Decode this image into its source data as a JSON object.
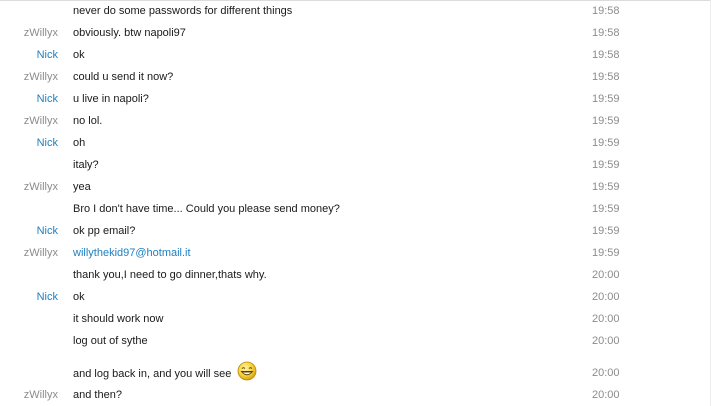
{
  "messages": [
    {
      "sender": "",
      "text": "never do some passwords for different things",
      "time": "19:58"
    },
    {
      "sender": "zWillyx",
      "text": "obviously. btw napoli97",
      "time": "19:58"
    },
    {
      "sender": "Nick",
      "text": "ok",
      "time": "19:58"
    },
    {
      "sender": "zWillyx",
      "text": "could u send it now?",
      "time": "19:58"
    },
    {
      "sender": "Nick",
      "text": "u live in napoli?",
      "time": "19:59"
    },
    {
      "sender": "zWillyx",
      "text": "no lol.",
      "time": "19:59"
    },
    {
      "sender": "Nick",
      "text": "oh",
      "time": "19:59"
    },
    {
      "sender": "",
      "text": "italy?",
      "time": "19:59"
    },
    {
      "sender": "zWillyx",
      "text": "yea",
      "time": "19:59"
    },
    {
      "sender": "",
      "text": "Bro I don't have time... Could you please send money?",
      "time": "19:59"
    },
    {
      "sender": "Nick",
      "text": "ok pp email?",
      "time": "19:59"
    },
    {
      "sender": "zWillyx",
      "text": "willythekid97@hotmail.it",
      "time": "19:59"
    },
    {
      "sender": "",
      "text": "thank you,I need to go dinner,thats why.",
      "time": "20:00"
    },
    {
      "sender": "Nick",
      "text": "ok",
      "time": "20:00"
    },
    {
      "sender": "",
      "text": "it should work now",
      "time": "20:00"
    },
    {
      "sender": "",
      "text": "log out of sythe",
      "time": "20:00"
    },
    {
      "sender": "",
      "text": "and log back in, and you will see",
      "time": "20:00",
      "emoticon": "laughing-smiley-icon"
    },
    {
      "sender": "zWillyx",
      "text": "and then?",
      "time": "20:00"
    }
  ],
  "colors": {
    "nick": "#1f7fc0",
    "zwillyx": "#8c8c8c",
    "link": "#1f7fc0",
    "time": "#8c8c8c",
    "emoticon_face": "#f7d33b"
  }
}
